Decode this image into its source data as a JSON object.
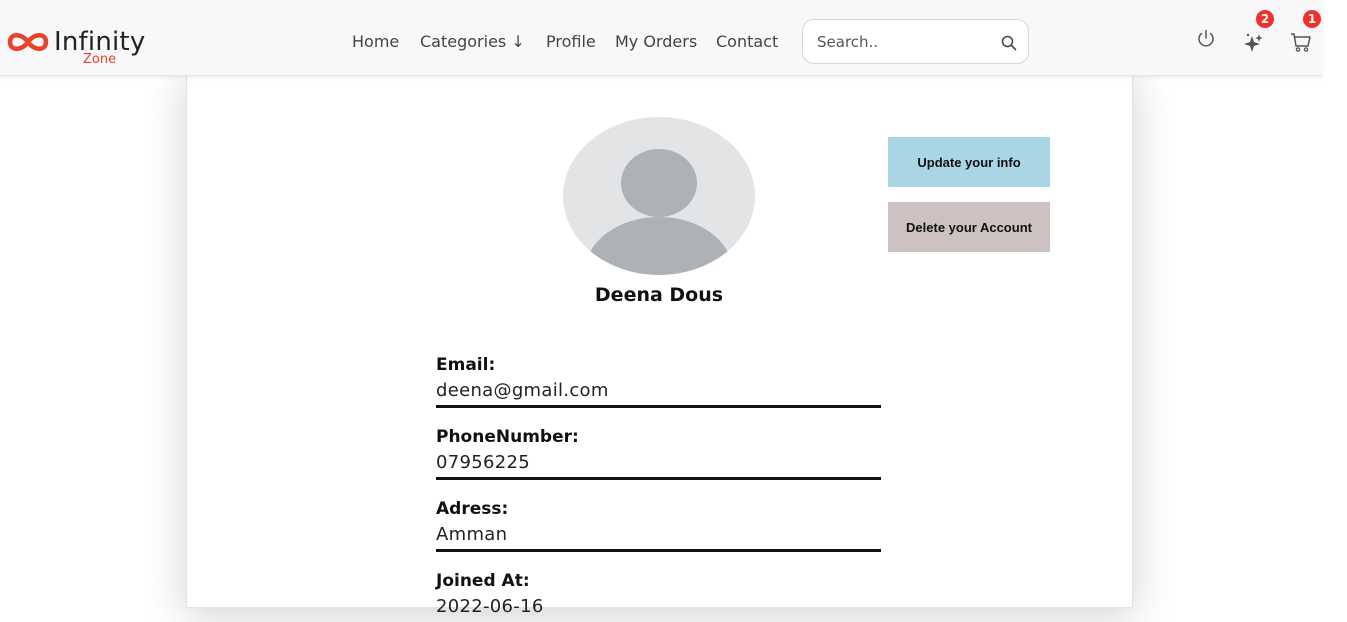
{
  "brand": {
    "name": "Infinity",
    "sub": "Zone",
    "accent": "#e8412c"
  },
  "nav": {
    "links": [
      "Home",
      "Categories ↓",
      "Profile",
      "My Orders",
      "Contact"
    ]
  },
  "search": {
    "placeholder": "Search.."
  },
  "icons": {
    "power": "power-icon",
    "sparkle": "sparkle-icon",
    "cart": "cart-icon"
  },
  "badges": {
    "sparkle_count": "2",
    "cart_count": "1"
  },
  "profile": {
    "name": "Deena Dous",
    "update_label": "Update your info",
    "delete_label": "Delete your Account",
    "fields": [
      {
        "label": "Email:",
        "value": "deena@gmail.com"
      },
      {
        "label": "PhoneNumber:",
        "value": "07956225"
      },
      {
        "label": "Adress:",
        "value": "Amman"
      },
      {
        "label": "Joined At:",
        "value": "2022-06-16"
      }
    ]
  },
  "colors": {
    "update_button": "#a9d5e4",
    "delete_button": "#cdc1c1",
    "badge": "#f0302c"
  }
}
